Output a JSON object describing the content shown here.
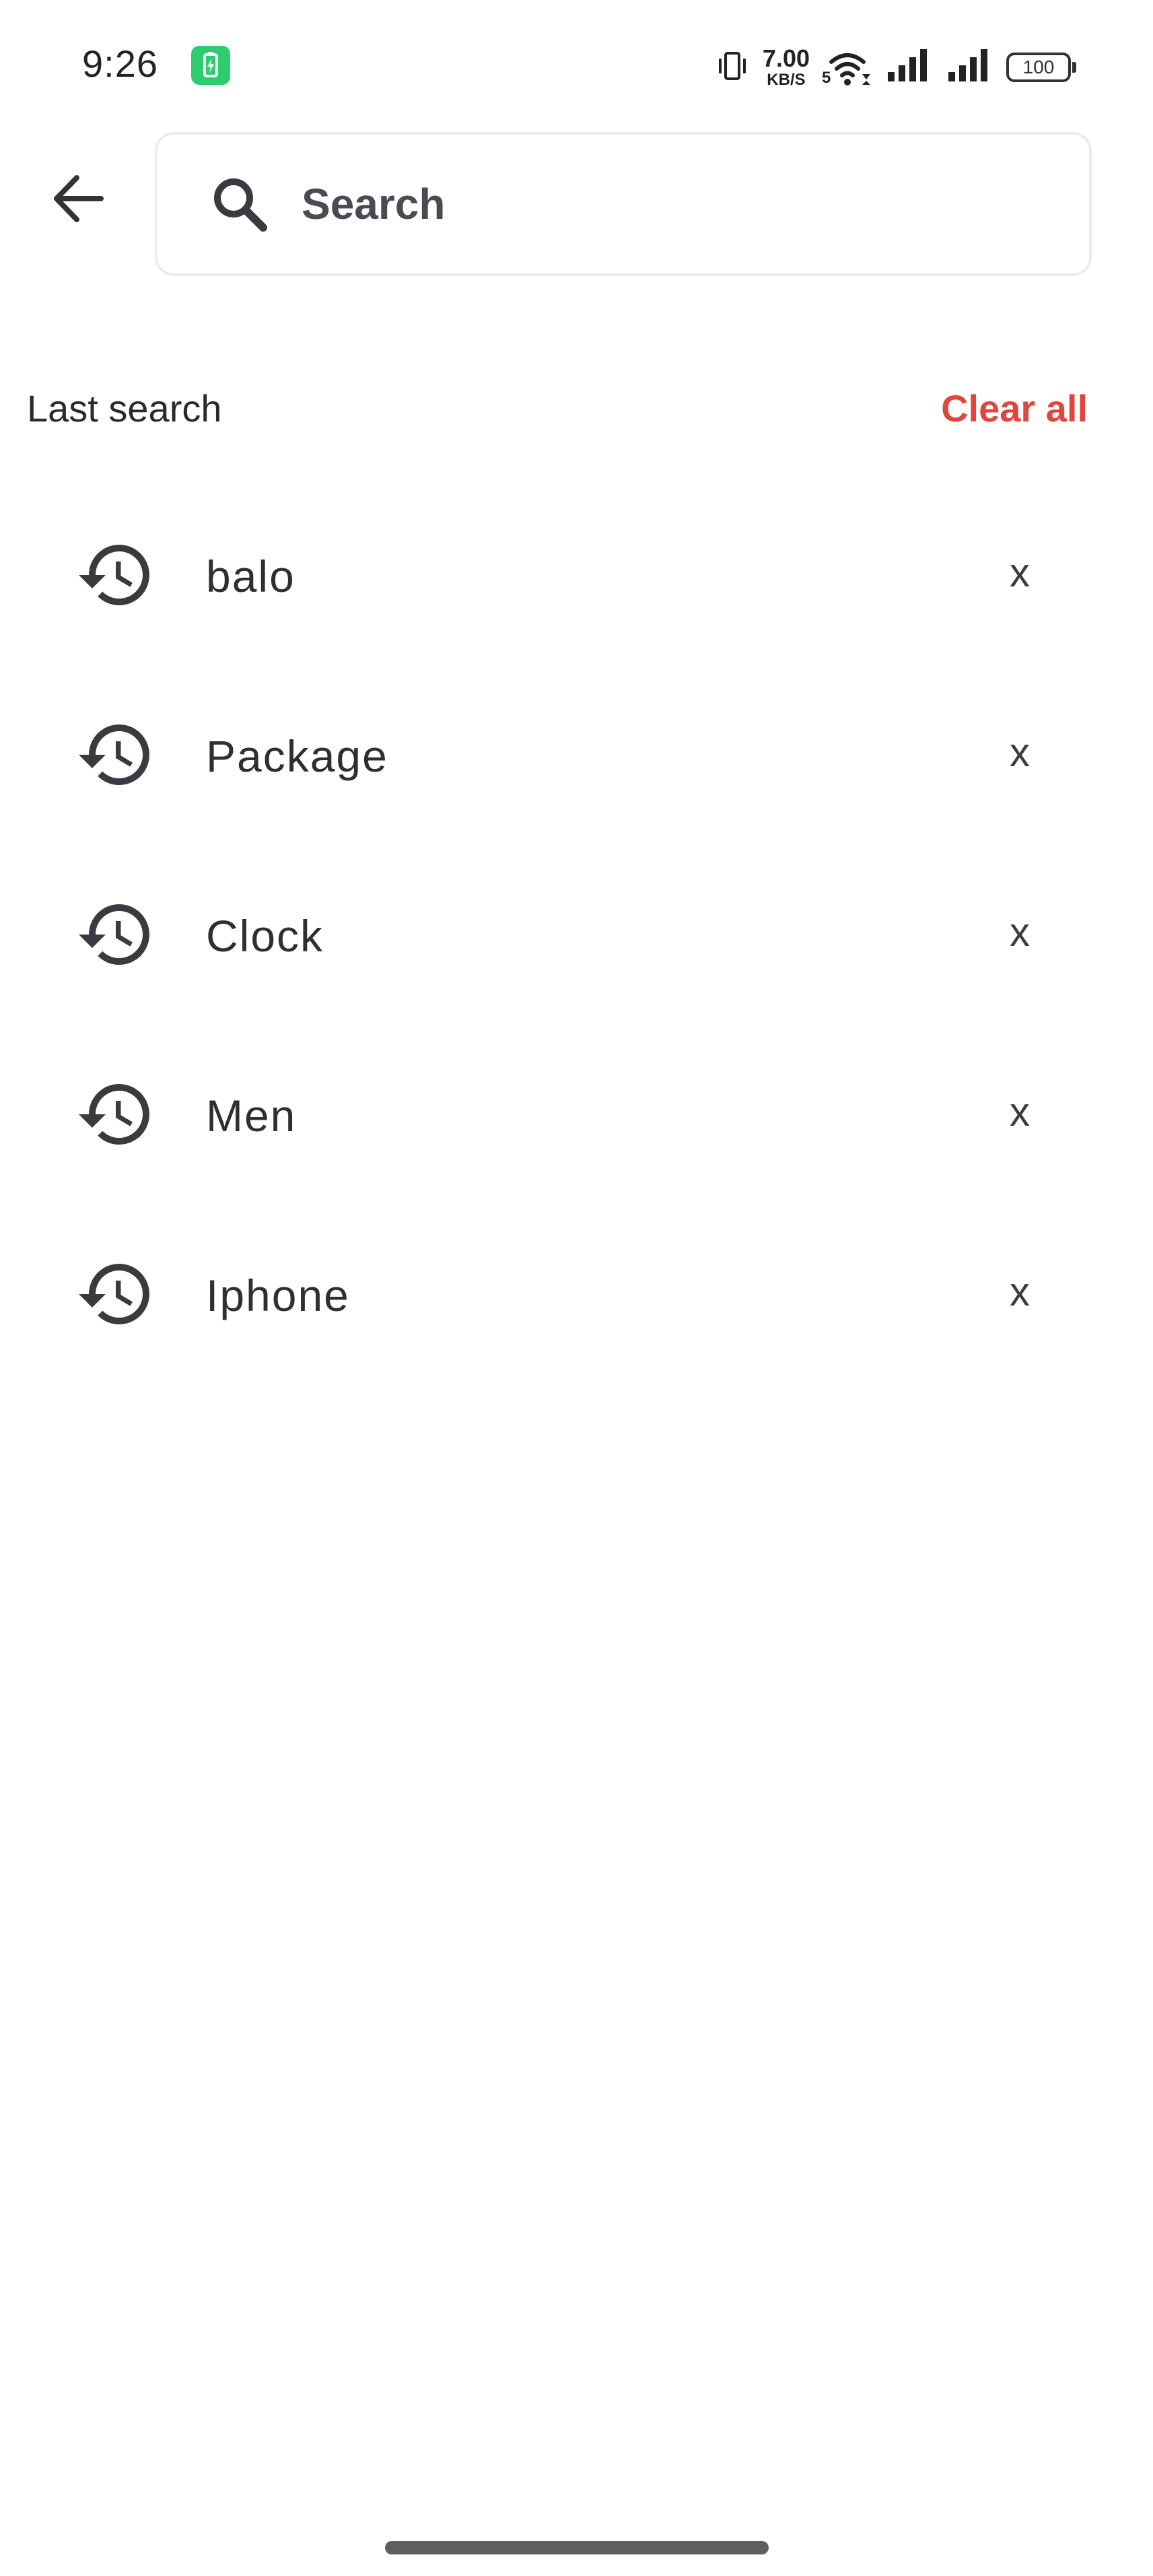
{
  "status_bar": {
    "time": "9:26",
    "battery_saver_icon": "battery-charging-icon",
    "net_speed_value": "7.00",
    "net_speed_unit": "KB/S",
    "wifi_badge": "5",
    "battery_level": "100"
  },
  "header": {
    "back_icon": "arrow-left-icon",
    "search_icon": "search-icon",
    "search_placeholder": "Search",
    "search_value": ""
  },
  "history": {
    "title": "Last search",
    "clear_all_label": "Clear all",
    "clear_all_color": "#e0463b",
    "item_icon": "history-icon",
    "remove_label": "x",
    "items": [
      {
        "label": "balo"
      },
      {
        "label": "Package"
      },
      {
        "label": "Clock"
      },
      {
        "label": "Men"
      },
      {
        "label": "Iphone"
      }
    ]
  }
}
